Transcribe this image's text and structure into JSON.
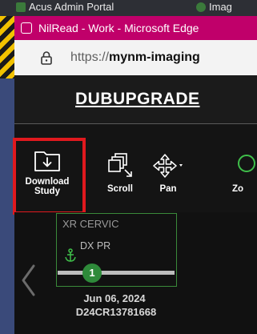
{
  "background": {
    "tab1_label": "Acus Admin Portal",
    "tab2_label": "Imag"
  },
  "browser": {
    "title": "NilRead - Work - Microsoft Edge",
    "url_prefix": "https://",
    "url_host": "mynm-imaging"
  },
  "app": {
    "study_title": "DUBUPGRADE",
    "toolbar": {
      "download_study_line1": "Download",
      "download_study_line2": "Study",
      "scroll_label": "Scroll",
      "pan_label": "Pan",
      "zoom_label": "Zo"
    },
    "thumbnail": {
      "series_line1": "XR CERVIC",
      "series_line2": "DX PR",
      "image_count": "1",
      "date": "Jun 06, 2024",
      "accession": "D24CR13781668"
    }
  },
  "colors": {
    "titlebar": "#c0006a",
    "highlight": "#e0191e",
    "badge": "#2e8a3a"
  }
}
